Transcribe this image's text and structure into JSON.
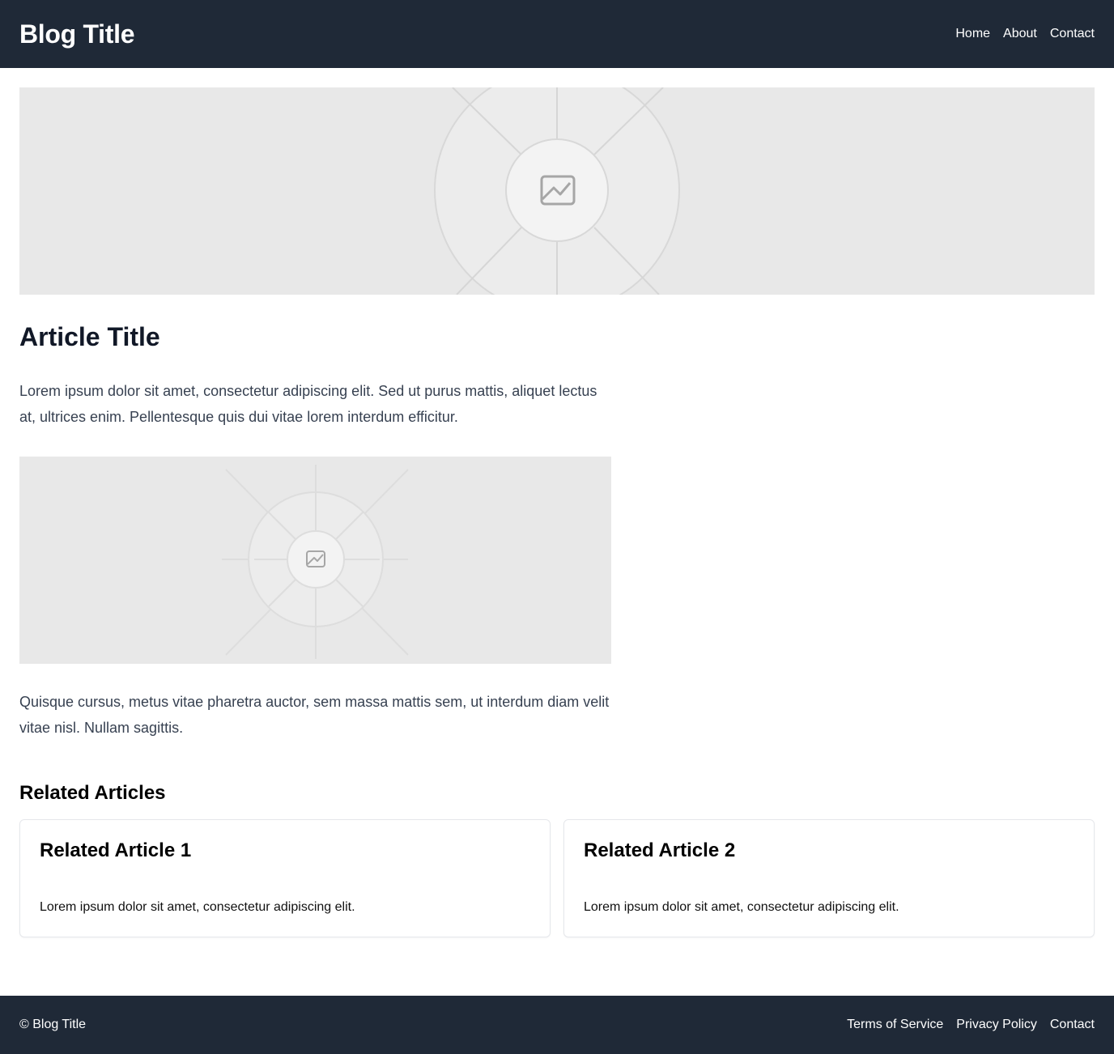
{
  "header": {
    "site_title": "Blog Title",
    "nav": [
      "Home",
      "About",
      "Contact"
    ]
  },
  "article": {
    "title": "Article Title",
    "paragraph_1": "Lorem ipsum dolor sit amet, consectetur adipiscing elit. Sed ut purus mattis, aliquet lectus at, ultrices enim. Pellentesque quis dui vitae lorem interdum efficitur.",
    "paragraph_2": "Quisque cursus, metus vitae pharetra auctor, sem massa mattis sem, ut interdum diam velit vitae nisl. Nullam sagittis."
  },
  "related": {
    "heading": "Related Articles",
    "cards": [
      {
        "title": "Related Article 1",
        "text": "Lorem ipsum dolor sit amet, consectetur adipiscing elit."
      },
      {
        "title": "Related Article 2",
        "text": "Lorem ipsum dolor sit amet, consectetur adipiscing elit."
      }
    ]
  },
  "footer": {
    "copyright": "© Blog Title",
    "links": [
      "Terms of Service",
      "Privacy Policy",
      "Contact"
    ]
  },
  "colors": {
    "header_bg": "#1f2937",
    "placeholder_bg": "#e8e8e8",
    "body_text": "#374151"
  },
  "icons": {
    "image_placeholder": "image-icon"
  }
}
